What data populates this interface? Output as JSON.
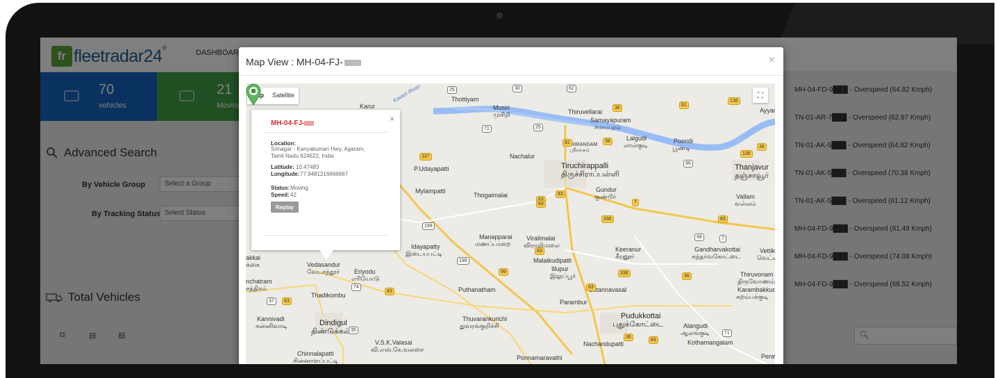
{
  "app": {
    "logo": {
      "badge": "fr",
      "name": "fleetradar24",
      "reg": "®"
    },
    "nav": {
      "dashboard": "DASHBOARD"
    },
    "stats": [
      {
        "value": "70",
        "label": "vehicles"
      },
      {
        "value": "21",
        "label": "Moving"
      }
    ],
    "advanced_search": {
      "title": "Advanced Search",
      "group_label": "By Vehicle Group",
      "group_value": "Select a Group",
      "status_label": "By Tracking Status",
      "status_value": "Select Status"
    },
    "total_vehicles": {
      "title": "Total Vehicles"
    },
    "alerts": [
      "MH-04-FD-9███ - Overspeed (64.82 Kmph)",
      "TN-01-AR-7███ - Overspeed (62.97 Kmph)",
      "TN-01-AK-5███ - Overspeed (64.82 Kmph)",
      "TN-01-AK-5███ - Overspeed (70.38 Kmph)",
      "TN-01-AK-5███ - Overspeed (61.12 Kmph)",
      "MH-04-FD-9███ - Overspeed (81.49 Kmph)",
      "MH-04-FD-9███ - Overspeed (74.08 Kmph)",
      "MH-04-FD-9███ - Overspeed (68.52 Kmph)"
    ]
  },
  "modal": {
    "title": "Map View : MH-04-FJ-",
    "close": "×",
    "map_type": {
      "map": "Map",
      "satellite": "Satellite"
    },
    "fullscreen_icon": "fullscreen-icon",
    "info": {
      "title": "MH-04-FJ-",
      "close": "×",
      "location_label": "Location:",
      "location_value": "Srinagar - Kanyakumari Hwy, Agaram, Tamil Nadu 624622, India",
      "latitude_label": "Latitude:",
      "latitude_value": "10.47483",
      "longitude_label": "Longitude:",
      "longitude_value": "77.9481216666667",
      "status_label": "Status:",
      "status_value": "Moving",
      "speed_label": "Speed:",
      "speed_value": "42",
      "replay": "Replay"
    },
    "places": [
      {
        "name": "Karur"
      },
      {
        "name": "Thottiyam"
      },
      {
        "name": "Musiri"
      },
      {
        "name": "முசிறி"
      },
      {
        "name": "Thiruvellarai"
      },
      {
        "name": "Samayapuram"
      },
      {
        "name": "சமயபுரம்"
      },
      {
        "name": "Lalgudi"
      },
      {
        "name": "லால்குடி"
      },
      {
        "name": "Poondi"
      },
      {
        "name": "பூண்டி"
      },
      {
        "name": "Ayyampet"
      },
      {
        "name": "Kaveri River"
      },
      {
        "name": "SRIRANGAM"
      },
      {
        "name": "ஸ்ரீரங்கம்"
      },
      {
        "name": "P.Udayapatti"
      },
      {
        "name": "Nachalur"
      },
      {
        "name": "Tiruchirappalli"
      },
      {
        "name": "திருச்சிராப்பள்ளி"
      },
      {
        "name": "Thanjavur"
      },
      {
        "name": "தஞ்சாவூர்"
      },
      {
        "name": "Mylampatti"
      },
      {
        "name": "Thogaimalai"
      },
      {
        "name": "Gundur"
      },
      {
        "name": "குண்டூர்"
      },
      {
        "name": "Vallam"
      },
      {
        "name": "வல்லம்"
      },
      {
        "name": "Manapparai"
      },
      {
        "name": "மணப்பாறை"
      },
      {
        "name": "Viralimalai"
      },
      {
        "name": "விராலிமலை"
      },
      {
        "name": "Idayapatty"
      },
      {
        "name": "இடையபட்டி"
      },
      {
        "name": "Malaikudipatti"
      },
      {
        "name": "Keeranur"
      },
      {
        "name": "கீரனூர்"
      },
      {
        "name": "Gandharvakottai"
      },
      {
        "name": "கந்தர்வகோட்டை"
      },
      {
        "name": "Vettikadu"
      },
      {
        "name": "வெட்டி"
      },
      {
        "name": "Vedasandur"
      },
      {
        "name": "வேடசந்தூர்"
      },
      {
        "name": "Eriyodu"
      },
      {
        "name": "எரியோடு"
      },
      {
        "name": "Illupur"
      },
      {
        "name": "இலுப்பூர்"
      },
      {
        "name": "Thiruvonam"
      },
      {
        "name": "திருவோணம்"
      },
      {
        "name": "Puthanatham"
      },
      {
        "name": "Sittannavasal"
      },
      {
        "name": "Karambakkudi"
      },
      {
        "name": "கறம்பக்குடி"
      },
      {
        "name": "Thadikombu"
      },
      {
        "name": "Parambur"
      },
      {
        "name": "Pudukkottai"
      },
      {
        "name": "புதுக்கோட்டை"
      },
      {
        "name": "Kannivadi"
      },
      {
        "name": "கன்னிவாடி"
      },
      {
        "name": "Dindigul"
      },
      {
        "name": "திண்டுக்கல்"
      },
      {
        "name": "Thuvarankurichi"
      },
      {
        "name": "துவரங்குறிச்சி"
      },
      {
        "name": "Alangudi"
      },
      {
        "name": "ஆலங்குடி"
      },
      {
        "name": "V.S.K.Valasai"
      },
      {
        "name": "வி.எஸ்.கே.வலசை"
      },
      {
        "name": "Nachandupatti"
      },
      {
        "name": "Kothamangalam"
      },
      {
        "name": "Chinnalapatti"
      },
      {
        "name": "சின்னாளப்பட்டி"
      },
      {
        "name": "Ponnamaravathi"
      },
      {
        "name": "Perav"
      },
      {
        "name": "nchatram"
      },
      {
        "name": "சத்திரம்"
      },
      {
        "name": "akkai"
      },
      {
        "name": "க்கை"
      }
    ],
    "shields": [
      "25",
      "30",
      "62",
      "38",
      "81",
      "136",
      "71",
      "25",
      "38",
      "81",
      "36",
      "136",
      "99",
      "99",
      "83",
      "83",
      "337",
      "336",
      "199",
      "7",
      "199",
      "83",
      "83",
      "99",
      "83",
      "36",
      "74",
      "336",
      "83",
      "83",
      "7",
      "37",
      "83",
      "36",
      "71",
      "83",
      "35",
      "38"
    ]
  },
  "colors": {
    "accent_blue": "#1565c0",
    "accent_green": "#43a047",
    "marker_green": "#5cb85c",
    "info_title_red": "#d32f2f",
    "river": "#8ab4f8"
  }
}
